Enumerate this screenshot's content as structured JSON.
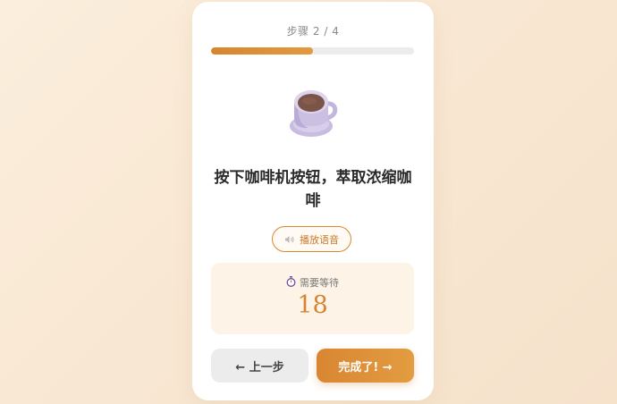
{
  "step": {
    "label": "步骤 2 / 4",
    "progress_fraction": 0.5
  },
  "illustration": {
    "icon": "coffee-cup-icon"
  },
  "instruction": {
    "text": "按下咖啡机按钮，萃取浓缩咖啡"
  },
  "voice_button": {
    "icon": "speaker-icon",
    "label": "播放语音"
  },
  "wait": {
    "icon": "stopwatch-icon",
    "label": "需要等待",
    "count": "18"
  },
  "nav": {
    "prev_label": "← 上一步",
    "done_label": "完成了! →"
  },
  "colors": {
    "accent": "#d98633",
    "background": "#f8e7d2",
    "wait_box": "#fdf4e7"
  }
}
